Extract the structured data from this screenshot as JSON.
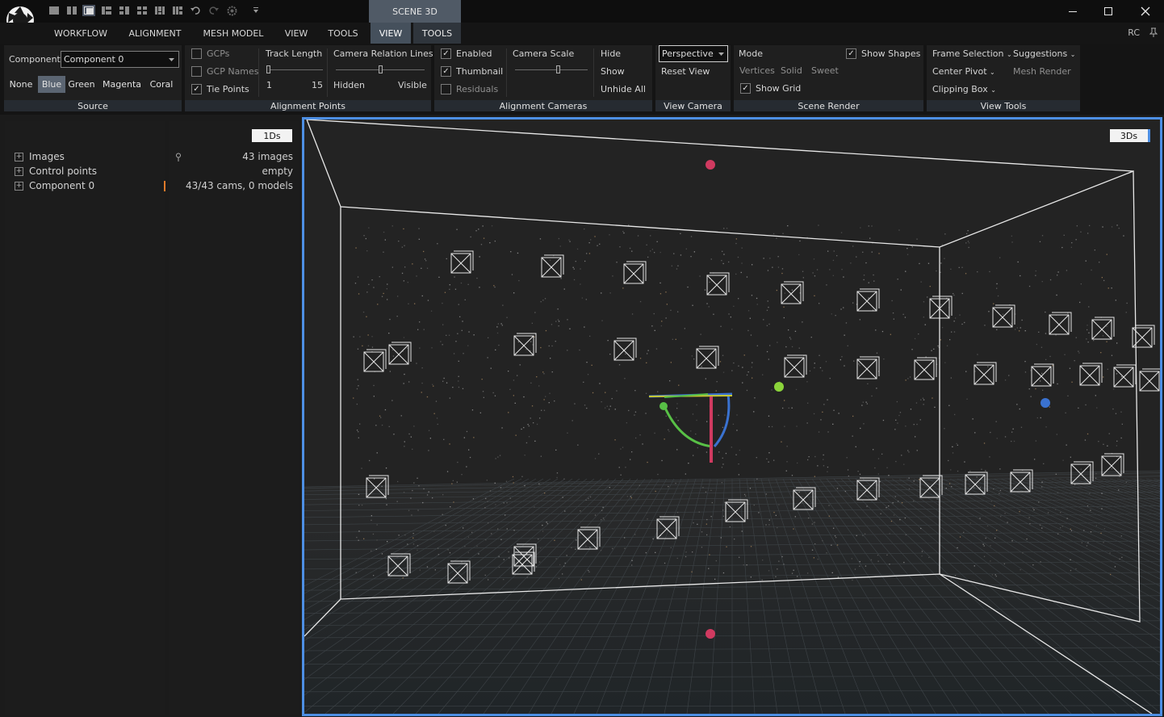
{
  "title_bar": {
    "context_tab": "SCENE 3D",
    "quick_access_icons": [
      "layout-1-icon",
      "layout-2-icon",
      "layout-3-icon",
      "layout-4-icon",
      "layout-5-icon",
      "layout-6-icon",
      "layout-7-icon",
      "layout-8-icon",
      "undo-icon",
      "redo-icon",
      "settings-icon",
      "customize-icon"
    ]
  },
  "menu": {
    "items": [
      "WORKFLOW",
      "ALIGNMENT",
      "MESH MODEL",
      "VIEW",
      "TOOLS",
      "VIEW",
      "TOOLS"
    ],
    "active_index": 5,
    "corner_label": "RC"
  },
  "ribbon": {
    "source": {
      "label": "Source",
      "component_label": "Component",
      "component_value": "Component 0",
      "colors": [
        "None",
        "Blue",
        "Green",
        "Magenta",
        "Coral"
      ],
      "active_color": "Blue"
    },
    "alignment_points": {
      "label": "Alignment Points",
      "checkboxes": [
        {
          "label": "GCPs",
          "checked": false
        },
        {
          "label": "GCP Names",
          "checked": false
        },
        {
          "label": "Tie Points",
          "checked": true
        }
      ],
      "track_length": {
        "label": "Track Length",
        "min": "1",
        "max": "15"
      },
      "camera_relation_lines": {
        "label": "Camera Relation Lines",
        "min_label": "Hidden",
        "max_label": "Visible"
      }
    },
    "alignment_cameras": {
      "label": "Alignment Cameras",
      "checkboxes": [
        {
          "label": "Enabled",
          "checked": true
        },
        {
          "label": "Thumbnail",
          "checked": true
        },
        {
          "label": "Residuals",
          "checked": false
        }
      ],
      "camera_scale": "Camera Scale",
      "buttons": [
        "Hide",
        "Show",
        "Unhide All"
      ]
    },
    "view_camera": {
      "label": "View Camera",
      "projection": "Perspective",
      "reset": "Reset View"
    },
    "scene_render": {
      "label": "Scene Render",
      "mode": "Mode",
      "modes": [
        "Vertices",
        "Solid",
        "Sweet"
      ],
      "show_shapes": {
        "label": "Show Shapes",
        "checked": true
      },
      "show_grid": {
        "label": "Show Grid",
        "checked": true
      }
    },
    "view_tools": {
      "label": "View Tools",
      "frame_selection": "Frame Selection",
      "suggestions": "Suggestions",
      "center_pivot": "Center Pivot",
      "mesh_render": "Mesh Render",
      "clipping_box": "Clipping Box"
    }
  },
  "panel_1ds": {
    "tag": "1Ds",
    "tree": [
      {
        "label": "Images",
        "info": "43 images"
      },
      {
        "label": "Control points",
        "info": "empty"
      },
      {
        "label": "Component 0",
        "info": "43/43 cams, 0 models"
      }
    ]
  },
  "viewport_3ds": {
    "tag": "3Ds"
  },
  "colors": {
    "accent": "#4d8fe4",
    "active_tab": "#45505c",
    "gizmo_x": "#d03a60",
    "gizmo_y": "#58c046",
    "gizmo_z": "#3a72d0"
  }
}
